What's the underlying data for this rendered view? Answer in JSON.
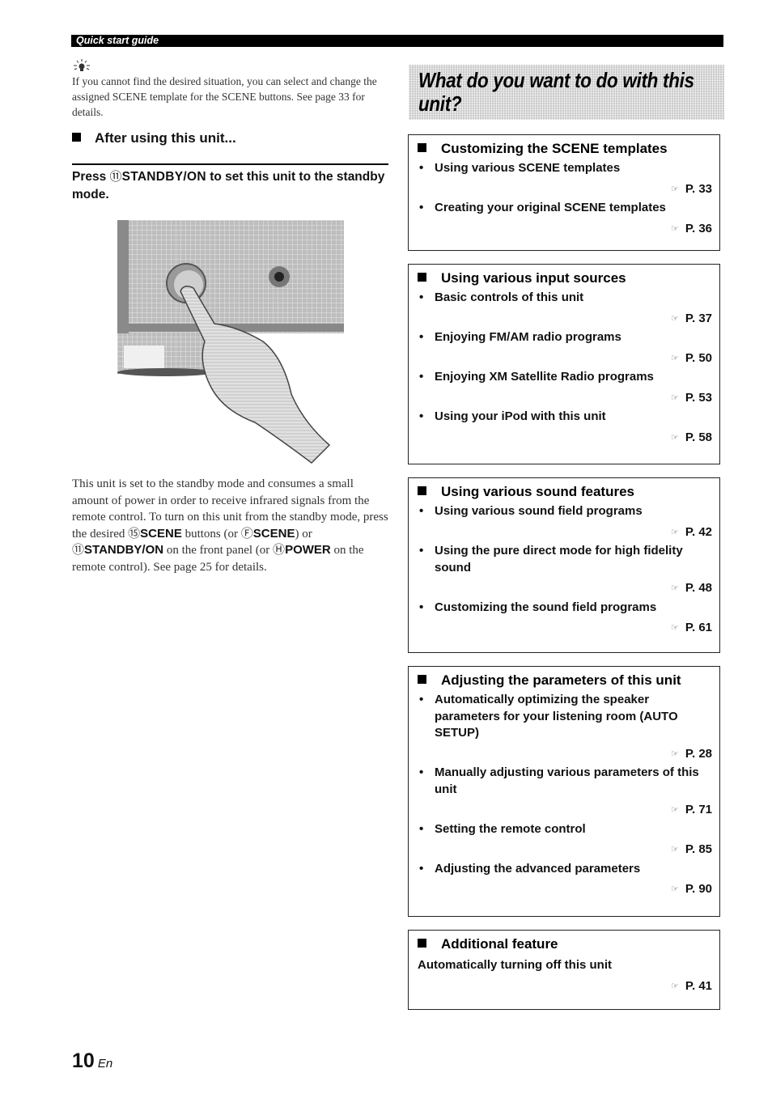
{
  "header": {
    "section_label": "Quick start guide"
  },
  "tip": {
    "icon": "lightbulb-tip-icon",
    "text": "If you cannot find the desired situation, you can select and change the assigned SCENE template for the SCENE buttons. See page 33 for details."
  },
  "after_using": {
    "heading": "After using this unit...",
    "instruction": {
      "prefix": "Press ",
      "key_number": "⑪",
      "key_label": "STANDBY/ON",
      "suffix": " to set this unit to the standby mode."
    },
    "illustration": "Hand pressing the STANDBY/ON button on the front panel",
    "body": {
      "t1": "This unit is set to the standby mode and consumes a small amount of power in order to receive infrared signals from the remote control. To turn on this unit from the standby mode, press the desired ",
      "k1_num": "⑮",
      "k1": "SCENE",
      "t2": " buttons (or ",
      "k2_num": "Ⓕ",
      "k2": "SCENE",
      "t3": ") or ",
      "k3_num": "⑪",
      "k3": "STANDBY/ON",
      "t4": " on the front panel (or ",
      "k4_num": "Ⓗ",
      "k4": "POWER",
      "t5": " on the remote control). See page 25 for details."
    }
  },
  "page": {
    "number": "10",
    "lang": "En"
  },
  "right": {
    "title": "What do you want to do with this unit?",
    "ref_icon": "☞",
    "sections": [
      {
        "title": "Customizing the SCENE templates",
        "items": [
          {
            "label": "Using various SCENE templates",
            "page": "P. 33"
          },
          {
            "label": "Creating your original SCENE templates",
            "page": "P. 36"
          }
        ]
      },
      {
        "title": "Using various input sources",
        "items": [
          {
            "label": "Basic controls of this unit",
            "page": "P. 37"
          },
          {
            "label": "Enjoying FM/AM radio programs",
            "page": "P. 50"
          },
          {
            "label": "Enjoying XM Satellite Radio programs",
            "page": "P. 53"
          },
          {
            "label": "Using your iPod with this unit",
            "page": "P. 58"
          }
        ]
      },
      {
        "title": "Using various sound features",
        "items": [
          {
            "label": "Using various sound field programs",
            "page": "P. 42"
          },
          {
            "label": "Using the pure direct mode for high fidelity sound",
            "page": "P. 48"
          },
          {
            "label": "Customizing the sound field programs",
            "page": "P. 61"
          }
        ]
      },
      {
        "title": "Adjusting the parameters of this unit",
        "items": [
          {
            "label": "Automatically optimizing the speaker parameters for your listening room (AUTO SETUP)",
            "page": "P. 28"
          },
          {
            "label": "Manually adjusting various parameters of this unit",
            "page": "P. 71"
          },
          {
            "label": "Setting the remote control",
            "page": "P. 85"
          },
          {
            "label": "Adjusting the advanced parameters",
            "page": "P. 90"
          }
        ]
      },
      {
        "title": "Additional feature",
        "items": [
          {
            "label": "Automatically turning off this unit",
            "page": "P. 41"
          }
        ]
      }
    ]
  }
}
